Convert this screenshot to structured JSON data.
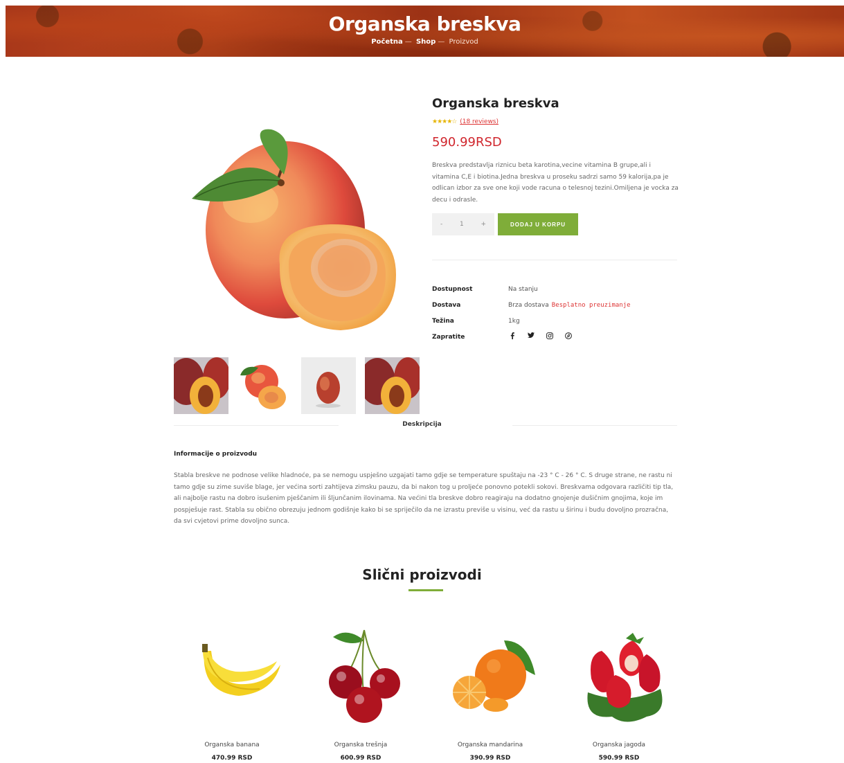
{
  "hero": {
    "title": "Organska breskva",
    "breadcrumb": {
      "home": "Početna",
      "shop": "Shop",
      "current": "Proizvod",
      "separator": "—"
    }
  },
  "product": {
    "title": "Organska breskva",
    "stars": "★★★★☆",
    "rating_fraction": 0.9,
    "reviews": "(18 reviews)",
    "price": "590.99RSD",
    "description": "Breskva predstavlja riznicu beta karotina,vecine vitamina B grupe,ali i vitamina C,E i biotina.Jedna breskva u proseku sadrzi samo 59 kalorija,pa je odlican izbor za sve one koji vode racuna o telesnoj tezini.Omiljena je vocka za decu i odrasle.",
    "quantity": {
      "minus": "-",
      "value": "1",
      "plus": "+"
    },
    "add_to_cart": "DODAJ U KORPU",
    "meta": {
      "availability_label": "Dostupnost",
      "availability_value": "Na stanju",
      "delivery_label": "Dostava",
      "delivery_value": "Brza dostava",
      "delivery_extra": "Besplatno preuzimanje",
      "weight_label": "Težina",
      "weight_value": "1kg",
      "follow_label": "Zapratite"
    },
    "social_icons": [
      "facebook-icon",
      "twitter-icon",
      "instagram-icon",
      "pinterest-icon"
    ]
  },
  "tabs": {
    "description": "Deskripcija"
  },
  "info": {
    "title": "Informacije o proizvodu",
    "text": "Stabla breskve ne podnose velike hladnoće, pa se nemogu uspješno uzgajati tamo gdje se temperature spuštaju na -23 ° C - 26 ° C. S druge strane, ne rastu ni tamo gdje su zime suviše blage, jer većina sorti zahtijeva zimsku pauzu, da bi nakon tog u proljeće ponovno potekli sokovi. Breskvama odgovara različiti tip tla, ali najbolje rastu na dobro isušenim pješčanim ili šljunčanim ilovinama. Na većini tla breskve dobro reagiraju na dodatno gnojenje dušičnim gnojima, koje im pospješuje rast. Stabla su obično obrezuju jednom godišnje kako bi se spriječilo da ne izrastu previše u visinu, već da rastu u širinu i budu dovoljno prozračna, da svi cvjetovi prime dovoljno sunca."
  },
  "related": {
    "title": "Slični proizvodi",
    "items": [
      {
        "name": "Organska banana",
        "price": "470.99 RSD"
      },
      {
        "name": "Organska trešnja",
        "price": "600.99 RSD"
      },
      {
        "name": "Organska mandarina",
        "price": "390.99 RSD"
      },
      {
        "name": "Organska jagoda",
        "price": "590.99 RSD"
      }
    ]
  },
  "colors": {
    "accent": "#7fad39",
    "price": "#d0262d",
    "stars": "#e6b400"
  }
}
